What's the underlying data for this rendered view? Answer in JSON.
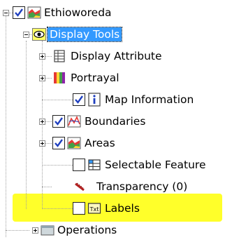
{
  "tree": {
    "root": {
      "label": "Ethioworeda",
      "checked": true,
      "expanded": true,
      "icon": "areas-layer-icon"
    },
    "display_tools": {
      "label": "Display Tools",
      "expanded": true,
      "selected": true,
      "icon": "eye-icon"
    },
    "items": [
      {
        "label": "Display Attribute",
        "has_children": true,
        "checkbox": false,
        "icon": "table-icon"
      },
      {
        "label": "Portrayal",
        "has_children": true,
        "checkbox": false,
        "icon": "color-bars-icon"
      },
      {
        "label": "Map Information",
        "has_children": false,
        "checkbox": true,
        "checked": true,
        "icon": "info-icon"
      },
      {
        "label": "Boundaries",
        "has_children": true,
        "checkbox": true,
        "checked": true,
        "icon": "boundary-icon"
      },
      {
        "label": "Areas",
        "has_children": true,
        "checkbox": true,
        "checked": true,
        "icon": "areas-layer-icon"
      },
      {
        "label": "Selectable Feature",
        "has_children": false,
        "checkbox": true,
        "checked": false,
        "icon": "grid-select-icon"
      },
      {
        "label": "Transparency (0)",
        "has_children": false,
        "checkbox": false,
        "icon": "brush-icon"
      },
      {
        "label": "Labels",
        "has_children": false,
        "checkbox": true,
        "checked": false,
        "icon": "text-label-icon",
        "highlighted": true
      }
    ],
    "operations": {
      "label": "Operations",
      "has_children": true,
      "icon": "folder-icon"
    }
  },
  "colors": {
    "selection": "#3399ff",
    "highlight": "#ffff2a"
  }
}
